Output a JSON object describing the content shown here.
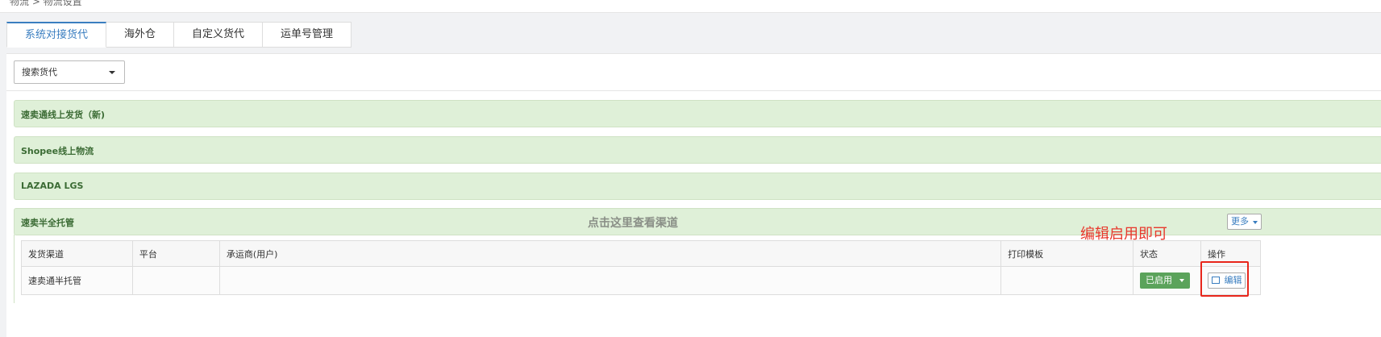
{
  "breadcrumb": {
    "text": "物流 > 物流设置"
  },
  "tabs": [
    {
      "label": "系统对接货代",
      "active": true
    },
    {
      "label": "海外仓",
      "active": false
    },
    {
      "label": "自定义货代",
      "active": false
    },
    {
      "label": "运单号管理",
      "active": false
    }
  ],
  "search": {
    "value": "搜索货代"
  },
  "groups": [
    {
      "title": "速卖通线上发货（新)"
    },
    {
      "title": "Shopee线上物流"
    },
    {
      "title": "LAZADA LGS"
    },
    {
      "title": "速卖半全托管",
      "hint": "点击这里查看渠道",
      "more_label": "更多"
    }
  ],
  "table": {
    "columns": [
      "发货渠道",
      "平台",
      "承运商(用户)",
      "打印模板",
      "状态",
      "操作"
    ],
    "rows": [
      {
        "channel": "速卖通半托管",
        "platform": "",
        "carrier": "",
        "template": "",
        "status": "已启用",
        "action": "编辑"
      }
    ]
  },
  "annotation": {
    "text": "编辑启用即可",
    "color": "#e8382c"
  },
  "colors": {
    "accent": "#3a7ec0",
    "group_bg": "#dff0d8",
    "status_green": "#5ba35b",
    "annotation_red": "#e8261b"
  }
}
